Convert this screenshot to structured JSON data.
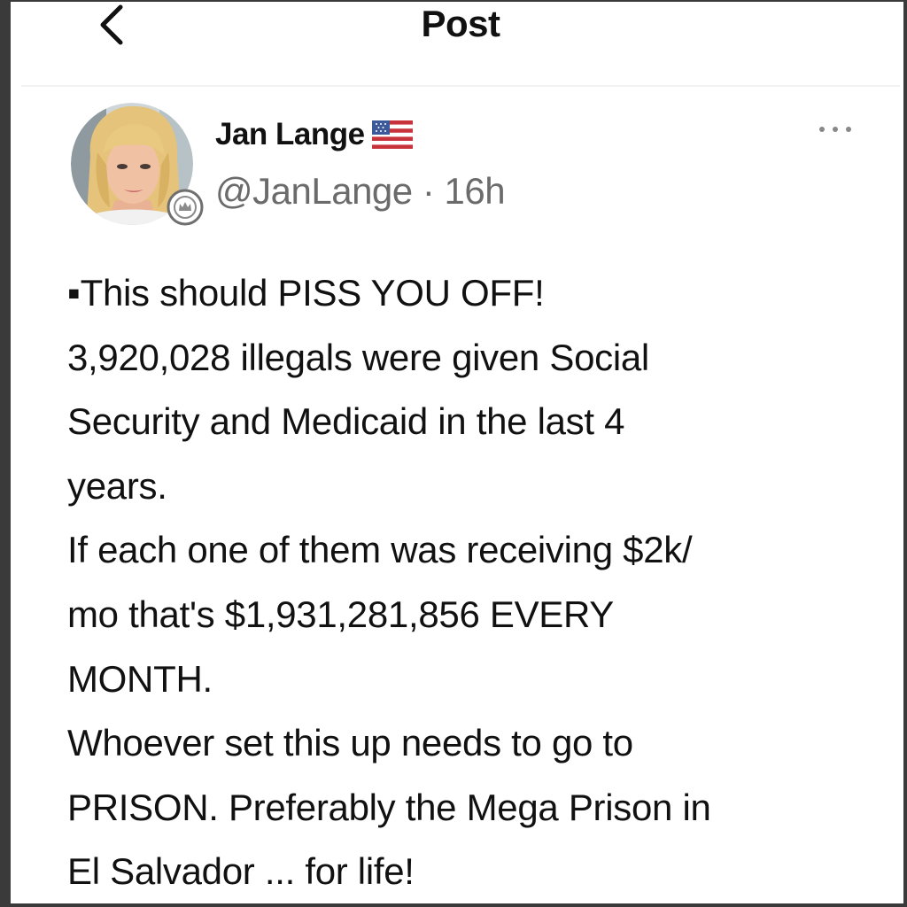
{
  "topbar": {
    "title": "Post",
    "back_icon": "chevron-left-icon"
  },
  "author": {
    "display_name": "Jan Lange",
    "flag_icon": "us-flag-icon",
    "handle": "@JanLange",
    "separator": " · ",
    "time": "16h",
    "avatar_icon": "avatar",
    "badge_icon": "verified-badge-icon"
  },
  "more_icon": "ellipsis-icon",
  "post": {
    "lines": [
      "▪This should PISS YOU OFF!",
      "3,920,028 illegals were given Social",
      "Security and Medicaid in the last 4",
      "years.",
      "If each one of them was receiving $2k/",
      "mo that's $1,931,281,856 EVERY",
      "MONTH.",
      "Whoever set this up needs to go to",
      "PRISON. Preferably the Mega Prison in",
      "El Salvador ... for life!"
    ]
  },
  "colors": {
    "text": "#111111",
    "muted": "#6b6b6b",
    "frame": "#3a3a3a"
  }
}
